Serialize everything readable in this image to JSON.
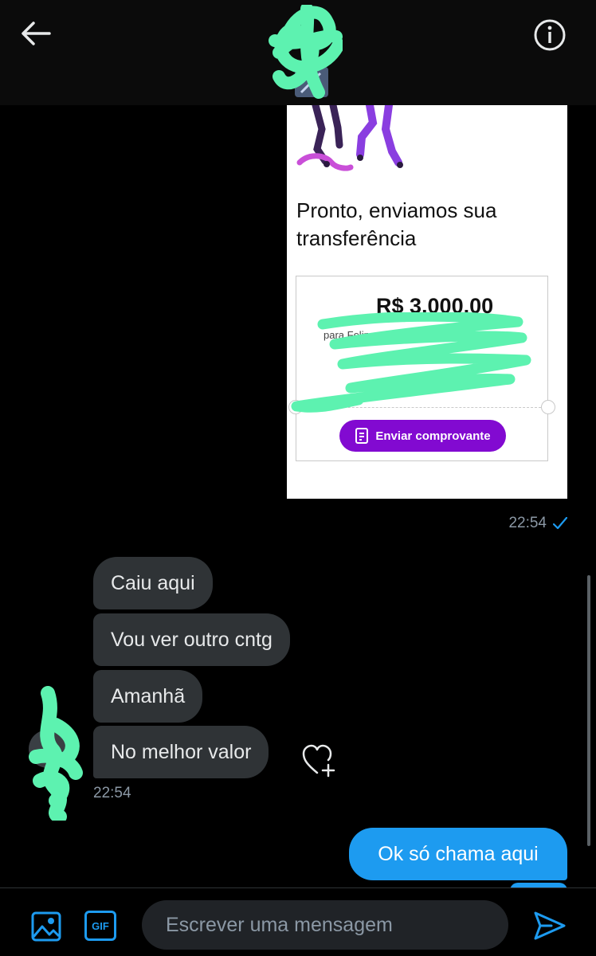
{
  "header": {
    "back_icon": "arrow-left-icon",
    "info_icon": "info-icon"
  },
  "receipt": {
    "title": "Pronto, enviamos sua transferência",
    "amount": "R$ 3,000,00",
    "to_text": "para Felin",
    "button_icon": "receipt-icon",
    "button_label": "Enviar comprovante",
    "accent_color": "#820ad1"
  },
  "sent_time": "22:54",
  "received": {
    "messages": [
      "Caiu aqui",
      "Vou ver outro cntg",
      "Amanhã",
      "No melhor valor"
    ],
    "time": "22:54",
    "reaction_icon": "heart-plus-icon"
  },
  "outgoing": {
    "text": "Ok só chama aqui",
    "color": "#1d9bf0"
  },
  "compose": {
    "media_icon": "image-icon",
    "gif_label": "GIF",
    "placeholder": "Escrever uma mensagem",
    "send_icon": "send-icon"
  },
  "colors": {
    "background": "#000000",
    "bubble_in": "#2f3336",
    "bubble_out": "#1d9bf0",
    "redaction_scribble": "#5df2b0"
  }
}
